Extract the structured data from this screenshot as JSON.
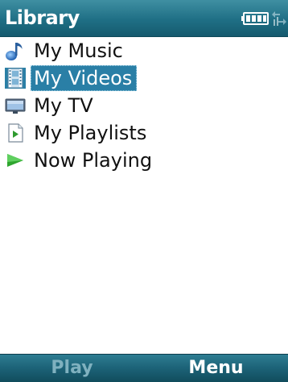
{
  "titlebar": {
    "title": "Library",
    "battery_icon": "battery-full-icon",
    "signal_icon": "signal-icon"
  },
  "list": {
    "items": [
      {
        "label": "My Music",
        "icon": "music-note-icon",
        "selected": false
      },
      {
        "label": "My Videos",
        "icon": "film-strip-icon",
        "selected": true
      },
      {
        "label": "My TV",
        "icon": "tv-icon",
        "selected": false
      },
      {
        "label": "My Playlists",
        "icon": "playlist-icon",
        "selected": false
      },
      {
        "label": "Now Playing",
        "icon": "play-arrow-icon",
        "selected": false
      }
    ]
  },
  "softkeys": {
    "left_label": "Play",
    "right_label": "Menu"
  },
  "colors": {
    "bar": "#1f6f85",
    "selection": "#2a7fa6",
    "left_softkey_disabled": "#7fb1bf"
  }
}
